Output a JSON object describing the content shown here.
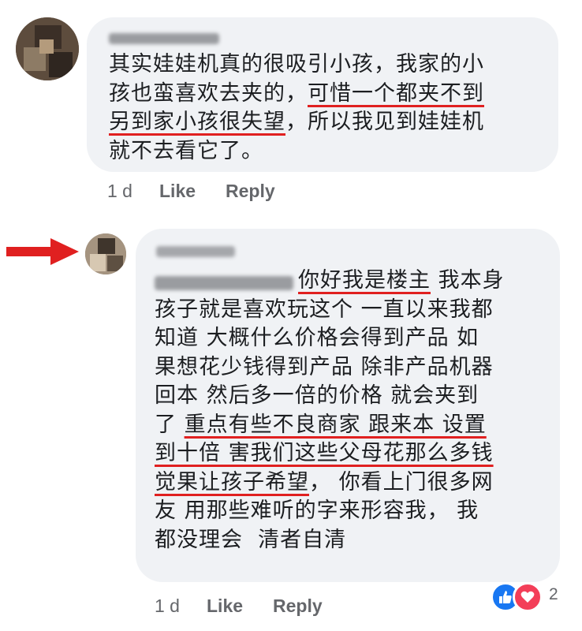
{
  "comment1": {
    "author": "Quenly Lee",
    "lines": [
      "其实娃娃机真的很吸引小孩，我家的小",
      "孩也蛮喜欢去夹的，",
      "可惜一个都夹不到",
      "另到家小孩很失望",
      "，所以我见到娃娃机",
      "就不去看它了。"
    ],
    "time": "1 d",
    "like_label": "Like",
    "reply_label": "Reply"
  },
  "comment2": {
    "author": "DNO-CR",
    "tag": "Quenly Lee",
    "lines": [
      "你好我是楼主",
      " 我本身",
      "孩子就是喜欢玩这个 一直以来我都",
      "知道 大概什么价格会得到产品 如",
      "果想花少钱得到产品 除非产品机器",
      "回本 然后多一倍的价格 就会夹到",
      "了 ",
      "重点有些不良商家 跟来本 设置",
      "到十倍 害我们这些父母花那么多钱",
      "觉果让孩子希望",
      "， 你看上门很多网",
      "友 用那些难听的字来形容我， 我",
      "都没理会  清者自清"
    ],
    "time": "1 d",
    "like_label": "Like",
    "reply_label": "Reply",
    "reaction_count": "2"
  },
  "colors": {
    "bubble": "#f0f2f5",
    "underline": "#e02020",
    "arrow": "#e02020",
    "like_blue": "#1877f2",
    "love_red": "#f33e58",
    "meta_gray": "#65676b"
  }
}
